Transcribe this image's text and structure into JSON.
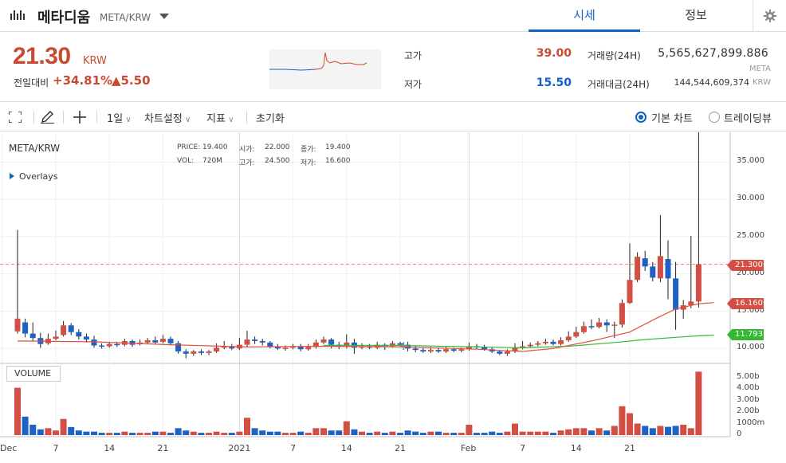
{
  "header": {
    "coin_name": "메타디움",
    "pair": "META/KRW",
    "tabs": [
      {
        "label": "시세",
        "active": true
      },
      {
        "label": "정보",
        "active": false
      }
    ]
  },
  "summary": {
    "price": "21.30",
    "price_unit": "KRW",
    "change_label": "전일대비",
    "change_rate": "+34.81%",
    "change_value": "▲5.50",
    "high_label": "고가",
    "high": "39.00",
    "low_label": "저가",
    "low": "15.50",
    "volume_label": "거래량(24H)",
    "volume": "5,565,627,899.886",
    "volume_unit": "META",
    "amount_label": "거래대금(24H)",
    "amount": "144,544,609,374",
    "amount_unit": "KRW"
  },
  "toolbar": {
    "interval": "1일",
    "chart_settings": "차트설정",
    "indicators": "지표",
    "reset": "초기화",
    "basic_chart": "기본 차트",
    "tradingview": "트레이딩뷰"
  },
  "chart": {
    "pair": "META/KRW",
    "overlays": "Overlays",
    "ohlc": {
      "price_label": "PRICE:",
      "price": "19.400",
      "open_label": "시가:",
      "open": "22.000",
      "close_label": "종가:",
      "close": "19.400",
      "vol_label": "VOL:",
      "vol": "720M",
      "high_label": "고가:",
      "high": "24.500",
      "low_label": "저가:",
      "low": "16.600"
    },
    "volume_label": "VOLUME",
    "badges": {
      "last": "21.300",
      "ma_red": "16.160",
      "ma_green": "11.793"
    },
    "colors": {
      "up": "#d24f45",
      "down": "#1d62c4",
      "ma_short": "#e0513e",
      "ma_long": "#35b935"
    }
  },
  "chart_data": {
    "type": "candlestick",
    "y_ticks": [
      "35.000",
      "30.000",
      "25.000",
      "20.000",
      "15.000",
      "10.000"
    ],
    "volume_ticks": [
      "5.00b",
      "4.00b",
      "3.00b",
      "2.00b",
      "1000m",
      "0"
    ],
    "x_ticks": [
      "Dec",
      "7",
      "14",
      "21",
      "2021",
      "7",
      "14",
      "21",
      "Feb",
      "7",
      "14",
      "21"
    ],
    "ylim": [
      8,
      39
    ],
    "candles": [
      [
        12.3,
        14.0,
        25.9,
        12.0,
        4.1
      ],
      [
        13.5,
        12.0,
        14.0,
        11.5,
        1.6
      ],
      [
        12.0,
        11.4,
        13.5,
        11.0,
        0.9
      ],
      [
        11.4,
        10.6,
        12.1,
        10.1,
        0.5
      ],
      [
        10.7,
        11.3,
        12.0,
        10.5,
        0.6
      ],
      [
        11.3,
        11.6,
        12.4,
        11.1,
        0.4
      ],
      [
        11.8,
        13.1,
        13.7,
        11.6,
        1.4
      ],
      [
        13.1,
        12.2,
        13.4,
        11.8,
        0.7
      ],
      [
        12.2,
        11.6,
        12.6,
        11.2,
        0.4
      ],
      [
        11.6,
        11.2,
        12.0,
        10.8,
        0.3
      ],
      [
        11.2,
        10.4,
        11.7,
        10.1,
        0.3
      ],
      [
        10.4,
        10.3,
        10.7,
        10.0,
        0.2
      ],
      [
        10.3,
        10.6,
        10.9,
        10.1,
        0.2
      ],
      [
        10.6,
        10.5,
        10.9,
        10.2,
        0.2
      ],
      [
        10.5,
        11.0,
        11.3,
        10.3,
        0.3
      ],
      [
        11.0,
        10.5,
        11.2,
        10.2,
        0.2
      ],
      [
        10.6,
        10.8,
        11.2,
        10.4,
        0.2
      ],
      [
        10.8,
        11.1,
        11.4,
        10.6,
        0.2
      ],
      [
        11.1,
        10.8,
        11.6,
        10.6,
        0.3
      ],
      [
        10.9,
        11.3,
        11.8,
        10.7,
        0.3
      ],
      [
        11.3,
        10.7,
        11.6,
        10.4,
        0.2
      ],
      [
        10.7,
        9.6,
        11.0,
        9.3,
        0.6
      ],
      [
        9.6,
        9.3,
        9.9,
        8.7,
        0.4
      ],
      [
        9.3,
        9.6,
        9.8,
        9.0,
        0.3
      ],
      [
        9.6,
        9.4,
        9.9,
        9.1,
        0.2
      ],
      [
        9.4,
        9.6,
        9.8,
        9.1,
        0.2
      ],
      [
        9.6,
        10.1,
        10.7,
        9.4,
        0.3
      ],
      [
        10.1,
        10.3,
        11.0,
        9.9,
        0.2
      ],
      [
        10.3,
        10.0,
        10.6,
        9.8,
        0.2
      ],
      [
        10.0,
        10.5,
        11.4,
        9.8,
        0.3
      ],
      [
        10.5,
        11.2,
        12.4,
        10.2,
        1.5
      ],
      [
        11.2,
        11.0,
        11.6,
        10.6,
        0.6
      ],
      [
        11.0,
        10.8,
        11.3,
        10.4,
        0.4
      ],
      [
        10.8,
        10.3,
        11.0,
        10.0,
        0.3
      ],
      [
        10.3,
        10.0,
        10.6,
        9.8,
        0.3
      ],
      [
        10.0,
        10.1,
        10.4,
        9.7,
        0.2
      ],
      [
        10.1,
        10.3,
        10.6,
        9.9,
        0.2
      ],
      [
        10.3,
        9.9,
        10.6,
        9.6,
        0.3
      ],
      [
        9.9,
        10.2,
        10.6,
        9.7,
        0.2
      ],
      [
        10.2,
        10.8,
        11.2,
        10.0,
        0.6
      ],
      [
        10.8,
        11.2,
        11.6,
        10.6,
        0.6
      ],
      [
        11.2,
        10.5,
        11.4,
        10.0,
        0.4
      ],
      [
        10.5,
        10.3,
        10.9,
        9.9,
        0.4
      ],
      [
        10.3,
        10.8,
        11.9,
        10.0,
        1.2
      ],
      [
        10.8,
        10.1,
        11.3,
        9.3,
        0.5
      ],
      [
        10.1,
        10.3,
        10.7,
        9.9,
        0.3
      ],
      [
        10.3,
        10.1,
        10.6,
        9.9,
        0.2
      ],
      [
        10.1,
        10.5,
        10.9,
        9.9,
        0.3
      ],
      [
        10.5,
        10.3,
        10.7,
        9.8,
        0.2
      ],
      [
        10.3,
        10.7,
        11.0,
        10.1,
        0.3
      ],
      [
        10.7,
        10.5,
        10.9,
        10.2,
        0.2
      ],
      [
        10.5,
        10.0,
        10.9,
        9.6,
        0.4
      ],
      [
        10.0,
        9.8,
        10.3,
        9.5,
        0.3
      ],
      [
        9.8,
        9.6,
        10.1,
        9.4,
        0.2
      ],
      [
        9.6,
        9.8,
        10.2,
        9.4,
        0.3
      ],
      [
        9.8,
        9.6,
        10.1,
        9.4,
        0.3
      ],
      [
        9.6,
        9.9,
        10.2,
        9.4,
        0.2
      ],
      [
        9.9,
        9.7,
        10.1,
        9.5,
        0.2
      ],
      [
        9.7,
        9.9,
        10.1,
        9.5,
        0.2
      ],
      [
        9.9,
        10.3,
        10.8,
        9.7,
        0.9
      ],
      [
        10.3,
        10.2,
        10.6,
        9.9,
        0.2
      ],
      [
        10.2,
        9.9,
        10.5,
        9.7,
        0.2
      ],
      [
        9.9,
        9.6,
        10.2,
        9.4,
        0.3
      ],
      [
        9.6,
        9.3,
        9.8,
        9.1,
        0.2
      ],
      [
        9.3,
        9.6,
        9.9,
        9.0,
        0.3
      ],
      [
        9.6,
        10.1,
        10.7,
        9.4,
        1.0
      ],
      [
        10.1,
        10.3,
        11.0,
        9.9,
        0.3
      ],
      [
        10.3,
        10.5,
        10.8,
        10.1,
        0.3
      ],
      [
        10.5,
        10.7,
        11.0,
        10.3,
        0.3
      ],
      [
        10.7,
        10.9,
        11.3,
        10.5,
        0.3
      ],
      [
        10.9,
        10.6,
        11.2,
        10.4,
        0.2
      ],
      [
        10.6,
        11.1,
        11.5,
        10.4,
        0.4
      ],
      [
        11.1,
        11.6,
        12.3,
        10.9,
        0.5
      ],
      [
        11.6,
        12.2,
        12.9,
        11.4,
        0.6
      ],
      [
        12.2,
        13.0,
        13.6,
        12.0,
        0.6
      ],
      [
        13.0,
        12.9,
        13.9,
        12.6,
        0.4
      ],
      [
        12.9,
        13.5,
        14.1,
        12.7,
        0.6
      ],
      [
        13.5,
        13.1,
        13.9,
        12.2,
        0.4
      ],
      [
        13.1,
        13.2,
        13.6,
        11.4,
        0.8
      ],
      [
        13.2,
        16.1,
        16.6,
        12.8,
        2.5
      ],
      [
        16.1,
        19.2,
        24.1,
        16.0,
        1.9
      ],
      [
        19.2,
        22.3,
        22.9,
        18.9,
        1.0
      ],
      [
        22.1,
        21.0,
        23.1,
        20.4,
        0.8
      ],
      [
        21.0,
        19.5,
        21.6,
        19.0,
        0.6
      ],
      [
        19.4,
        22.4,
        27.9,
        18.9,
        0.8
      ],
      [
        22.0,
        19.4,
        24.5,
        16.6,
        0.72
      ],
      [
        19.4,
        15.2,
        21.6,
        12.5,
        0.8
      ],
      [
        15.2,
        15.8,
        16.5,
        14.0,
        0.9
      ],
      [
        15.8,
        16.3,
        25.1,
        15.4,
        0.6
      ],
      [
        16.3,
        21.3,
        39.0,
        15.5,
        5.5
      ]
    ],
    "ma_short": [
      [
        0,
        11.0
      ],
      [
        10,
        10.9
      ],
      [
        20,
        10.5
      ],
      [
        30,
        10.2
      ],
      [
        40,
        10.3
      ],
      [
        50,
        10.2
      ],
      [
        60,
        9.9
      ],
      [
        66,
        9.6
      ],
      [
        70,
        10.0
      ],
      [
        75,
        11.0
      ],
      [
        80,
        12.2
      ],
      [
        83,
        13.8
      ],
      [
        86,
        15.3
      ],
      [
        89,
        16.0
      ],
      [
        91,
        16.16
      ]
    ],
    "ma_long": [
      [
        40,
        10.4
      ],
      [
        50,
        10.4
      ],
      [
        60,
        10.2
      ],
      [
        66,
        10.1
      ],
      [
        72,
        10.3
      ],
      [
        78,
        10.8
      ],
      [
        82,
        11.2
      ],
      [
        86,
        11.5
      ],
      [
        89,
        11.7
      ],
      [
        91,
        11.79
      ]
    ],
    "last_price": 21.3
  }
}
